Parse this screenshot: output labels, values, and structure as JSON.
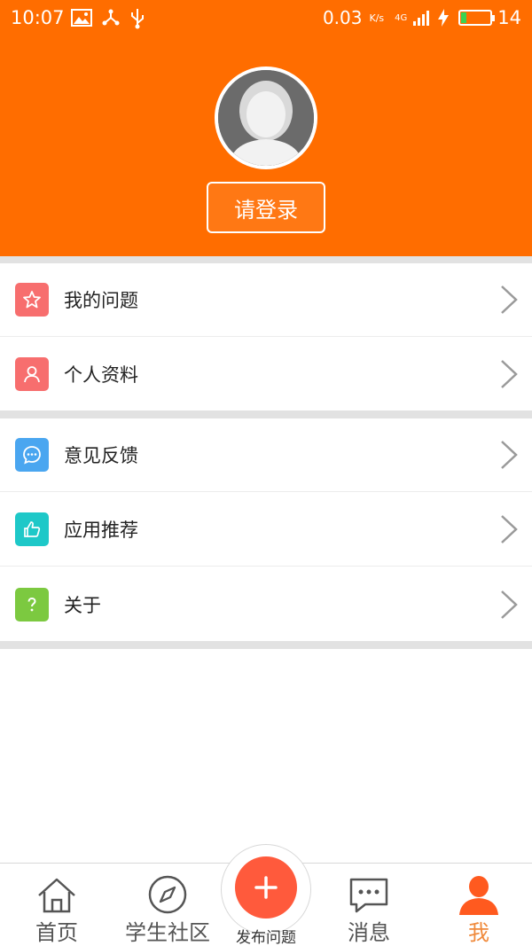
{
  "status_bar": {
    "time": "10:07",
    "net_speed": "0.03",
    "net_unit": "K/s",
    "signal_type": "4G",
    "battery_level": "14"
  },
  "profile": {
    "login_label": "请登录"
  },
  "menu": {
    "items": [
      {
        "label": "我的问题",
        "icon": "star-icon",
        "color": "#f76e6e"
      },
      {
        "label": "个人资料",
        "icon": "person-icon",
        "color": "#f76e6e"
      },
      {
        "label": "意见反馈",
        "icon": "chat-icon",
        "color": "#4aa6f0"
      },
      {
        "label": "应用推荐",
        "icon": "thumb-up-icon",
        "color": "#1ec8c8"
      },
      {
        "label": "关于",
        "icon": "question-icon",
        "color": "#7cc940"
      }
    ]
  },
  "tabbar": {
    "home": "首页",
    "community": "学生社区",
    "publish": "发布问题",
    "messages": "消息",
    "me": "我"
  },
  "colors": {
    "brand": "#ff6d00",
    "active_tab": "#f08a3c",
    "publish": "#ff5a3c"
  }
}
